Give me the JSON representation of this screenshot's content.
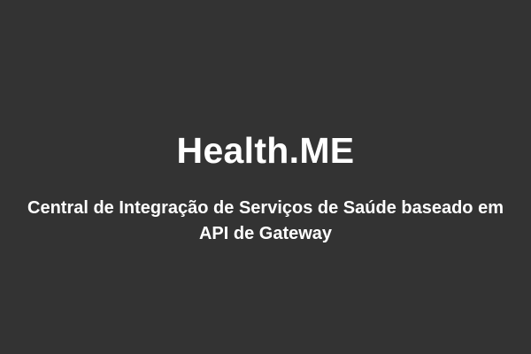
{
  "page": {
    "background_color": "#333333",
    "text_color": "#ffffff"
  },
  "content": {
    "title": "Health.ME",
    "subtitle_line1": "Central de Integração de Serviços de Saúde baseado em",
    "subtitle_line2": "API de Gateway"
  }
}
